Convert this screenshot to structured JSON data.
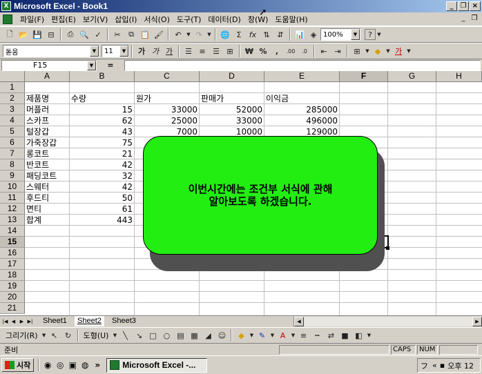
{
  "window": {
    "title": "Microsoft Excel - Book1",
    "minimize": "_",
    "restore": "❐",
    "close": "×"
  },
  "menu": [
    {
      "label": "파일(F)"
    },
    {
      "label": "편집(E)"
    },
    {
      "label": "보기(V)"
    },
    {
      "label": "삽입(I)"
    },
    {
      "label": "서식(O)"
    },
    {
      "label": "도구(T)"
    },
    {
      "label": "데이터(D)"
    },
    {
      "label": "창(W)"
    },
    {
      "label": "도움말(H)"
    }
  ],
  "standard_toolbar": {
    "zoom": "100%",
    "sum_symbol": "Σ",
    "function_symbol": "fx",
    "help_symbol": "?"
  },
  "format_toolbar": {
    "font": "돋움",
    "size": "11",
    "bold": "가",
    "italic": "가",
    "underline": "가",
    "currency": "₩",
    "percent": "%",
    "comma": ",",
    "increase_decimal": ".00",
    "decrease_decimal": ".0",
    "font_color": "가"
  },
  "formula_bar": {
    "name_box": "F15",
    "equals": "="
  },
  "grid": {
    "columns": [
      "A",
      "B",
      "C",
      "D",
      "E",
      "F",
      "G",
      "H"
    ],
    "active_column": "F",
    "rows": [
      "1",
      "2",
      "3",
      "4",
      "5",
      "6",
      "7",
      "8",
      "9",
      "10",
      "11",
      "12",
      "13",
      "14",
      "15",
      "16",
      "17",
      "18",
      "19",
      "20",
      "21"
    ],
    "active_row": "15",
    "headers": {
      "product": "제품명",
      "quantity": "수량",
      "cost": "원가",
      "price": "판매가",
      "profit": "이익금"
    },
    "items": [
      {
        "name": "머플러",
        "qty": "15",
        "cost": "33000",
        "price": "52000",
        "profit": "285000"
      },
      {
        "name": "스카프",
        "qty": "62",
        "cost": "25000",
        "price": "33000",
        "profit": "496000"
      },
      {
        "name": "털장갑",
        "qty": "43",
        "cost": "7000",
        "price": "10000",
        "profit": "129000"
      },
      {
        "name": "가죽장갑",
        "qty": "75"
      },
      {
        "name": "롱코트",
        "qty": "21"
      },
      {
        "name": "반코트",
        "qty": "42"
      },
      {
        "name": "패딩코트",
        "qty": "32"
      },
      {
        "name": "스웨터",
        "qty": "42"
      },
      {
        "name": "후드티",
        "qty": "50"
      },
      {
        "name": "면티",
        "qty": "61"
      }
    ],
    "total": {
      "label": "합계",
      "qty": "443"
    }
  },
  "callout": {
    "line1": "이번시간에는 조건부 서식에 관해",
    "line2": "알아보도록 하겠습니다.",
    "fill_color": "#22ee11"
  },
  "sheet_tabs": [
    {
      "label": "Sheet1"
    },
    {
      "label": "Sheet2",
      "active": true
    },
    {
      "label": "Sheet3"
    }
  ],
  "drawing_toolbar": {
    "draw_label": "그리기(R)",
    "autoshape_label": "도형(U)"
  },
  "status": {
    "ready": "준비",
    "caps": "CAPS",
    "num": "NUM"
  },
  "taskbar": {
    "start": "시작",
    "more": "»",
    "task": "Microsoft Excel -...",
    "tray_arrows": "«",
    "clock": "오후 12"
  }
}
